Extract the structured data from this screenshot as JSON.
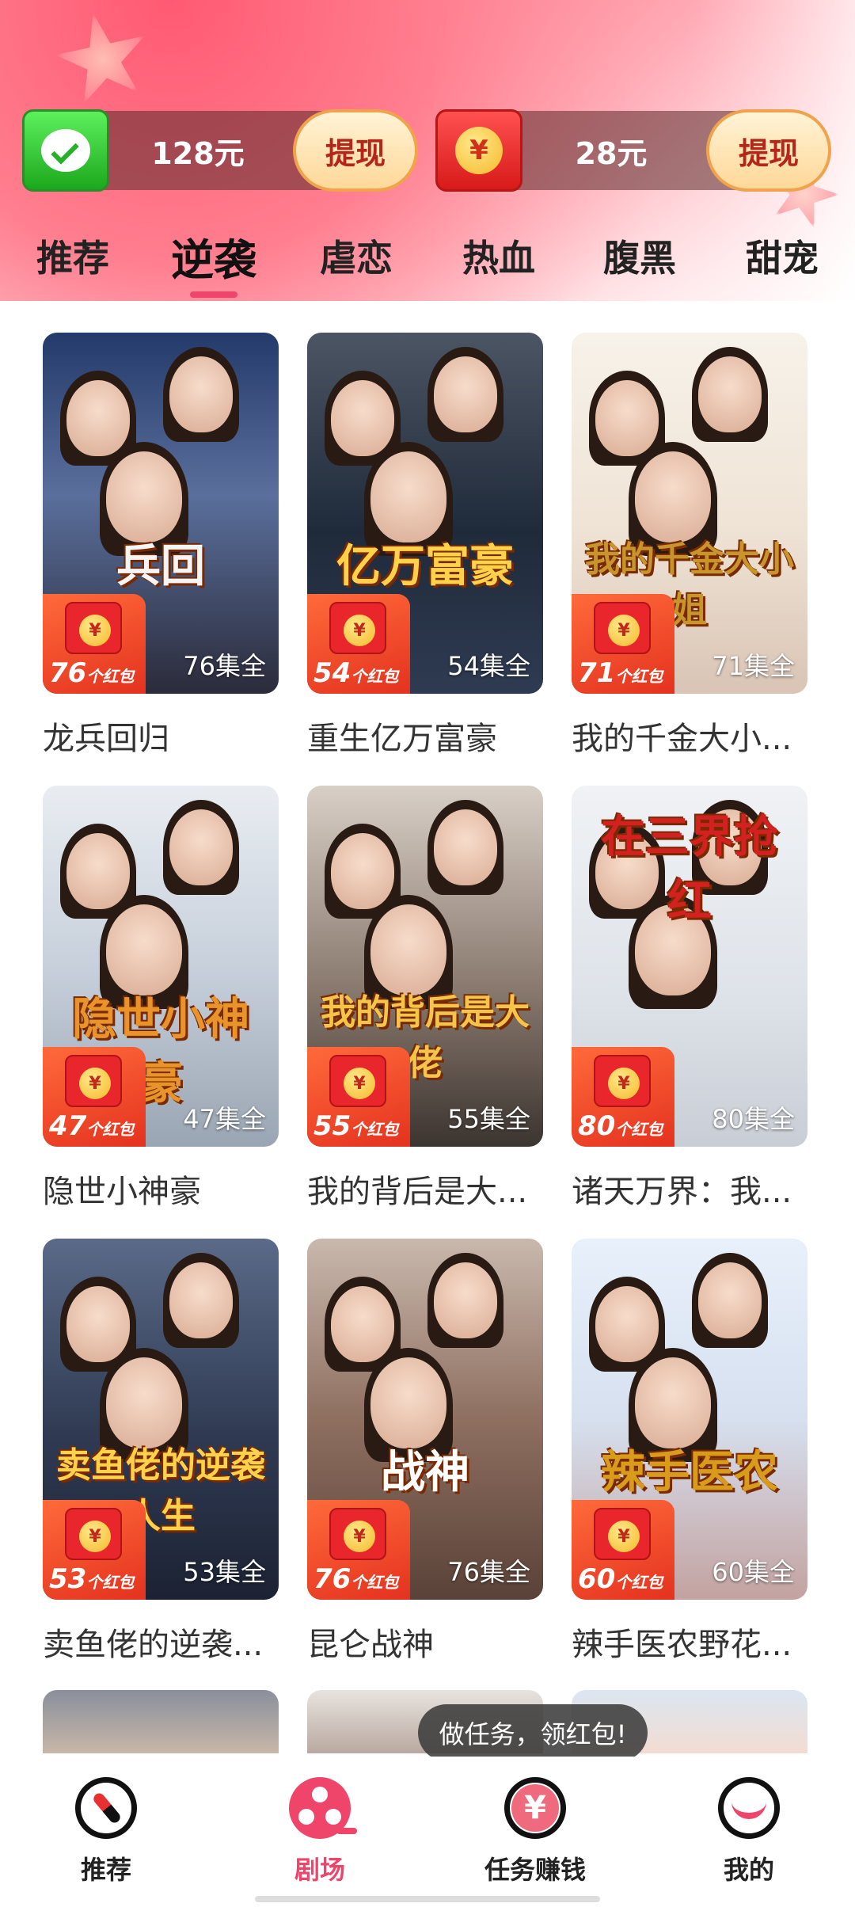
{
  "wallets": [
    {
      "amount": "128元",
      "button": "提现",
      "icon": "wechat-icon"
    },
    {
      "amount": "28元",
      "button": "提现",
      "icon": "red-envelope-icon"
    }
  ],
  "categories": [
    "推荐",
    "逆袭",
    "虐恋",
    "热血",
    "腹黑",
    "甜宠"
  ],
  "active_category": "逆袭",
  "dramas": [
    {
      "name": "龙兵回归",
      "episodes": "76集全",
      "redpack_count": "76",
      "redpack_unit": "个红包",
      "poster_text": "兵回"
    },
    {
      "name": "重生亿万富豪",
      "episodes": "54集全",
      "redpack_count": "54",
      "redpack_unit": "个红包",
      "poster_text": "亿万富豪"
    },
    {
      "name": "我的千金大小...",
      "episodes": "71集全",
      "redpack_count": "71",
      "redpack_unit": "个红包",
      "poster_text": "我的千金大小姐"
    },
    {
      "name": "隐世小神豪",
      "episodes": "47集全",
      "redpack_count": "47",
      "redpack_unit": "个红包",
      "poster_text": "隐世小神豪"
    },
    {
      "name": "我的背后是大...",
      "episodes": "55集全",
      "redpack_count": "55",
      "redpack_unit": "个红包",
      "poster_text": "我的背后是大佬"
    },
    {
      "name": "诸天万界：我...",
      "episodes": "80集全",
      "redpack_count": "80",
      "redpack_unit": "个红包",
      "poster_text": "在三界抢红"
    },
    {
      "name": "卖鱼佬的逆袭...",
      "episodes": "53集全",
      "redpack_count": "53",
      "redpack_unit": "个红包",
      "poster_text": "卖鱼佬的逆袭人生"
    },
    {
      "name": "昆仑战神",
      "episodes": "76集全",
      "redpack_count": "76",
      "redpack_unit": "个红包",
      "poster_text": "战神"
    },
    {
      "name": "辣手医农野花...",
      "episodes": "60集全",
      "redpack_count": "60",
      "redpack_unit": "个红包",
      "poster_text": "辣手医农"
    }
  ],
  "tooltip": "做任务，领红包!",
  "nav": [
    {
      "label": "推荐",
      "icon": "compass-icon"
    },
    {
      "label": "剧场",
      "icon": "film-reel-icon"
    },
    {
      "label": "任务赚钱",
      "icon": "yen-coin-icon"
    },
    {
      "label": "我的",
      "icon": "smile-icon"
    }
  ],
  "active_nav": "剧场",
  "colors": {
    "accent": "#f0456b",
    "redpack": "#e4321f",
    "gold": "#ffd24a"
  }
}
